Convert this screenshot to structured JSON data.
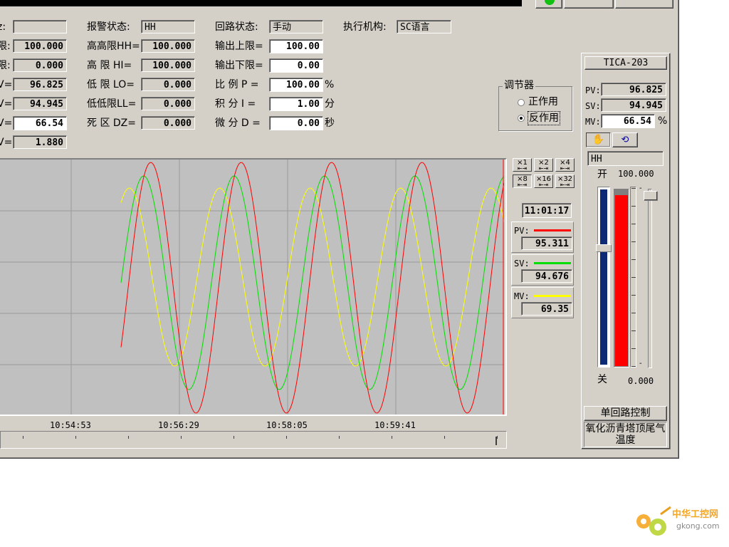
{
  "params": {
    "col1": [
      {
        "label": "z:",
        "value": ""
      },
      {
        "label": "限:",
        "value": "100.000"
      },
      {
        "label": "限:",
        "value": "0.000"
      },
      {
        "label": "V=",
        "value": "96.825"
      },
      {
        "label": "V=",
        "value": "94.945"
      },
      {
        "label": "V=",
        "value": "66.54"
      },
      {
        "label": "V=",
        "value": "1.880"
      }
    ],
    "col2": [
      {
        "label": "报警状态:",
        "value": "HH"
      },
      {
        "label": "高高限HH=",
        "value": "100.000"
      },
      {
        "label": "高 限 HI=",
        "value": "100.000"
      },
      {
        "label": "低 限 LO=",
        "value": "0.000"
      },
      {
        "label": "低低限LL=",
        "value": "0.000"
      },
      {
        "label": "死 区 DZ=",
        "value": "0.000"
      }
    ],
    "col3": [
      {
        "label": "回路状态:",
        "value": "手动",
        "unit": ""
      },
      {
        "label": "输出上限=",
        "value": "100.00",
        "unit": ""
      },
      {
        "label": "输出下限=",
        "value": "0.00",
        "unit": ""
      },
      {
        "label": "比 例 P =",
        "value": "100.00",
        "unit": "%"
      },
      {
        "label": "积 分 I =",
        "value": "1.00",
        "unit": "分"
      },
      {
        "label": "微 分 D =",
        "value": "0.00",
        "unit": "秒"
      }
    ],
    "actuator": {
      "label": "执行机构:",
      "value": "SC语言"
    }
  },
  "regulator": {
    "title": "调节器",
    "options": [
      {
        "label": "正作用",
        "selected": false
      },
      {
        "label": "反作用",
        "selected": true
      }
    ]
  },
  "zoom_buttons": [
    "×1",
    "×2",
    "×4",
    "×8",
    "×16",
    "×32"
  ],
  "zoom_selected": "×8",
  "trend": {
    "time": "11:01:17",
    "legend": [
      {
        "name": "PV:",
        "value": "95.311",
        "color": "#ff0000"
      },
      {
        "name": "SV:",
        "value": "94.676",
        "color": "#00dd00"
      },
      {
        "name": "MV:",
        "value": "69.35",
        "color": "#ffff00"
      }
    ],
    "time_labels": [
      "10:54:53",
      "10:56:29",
      "10:58:05",
      "10:59:41"
    ]
  },
  "faceplate": {
    "tag": "TICA-203",
    "pv_label": "PV:",
    "pv": "96.825",
    "sv_label": "SV:",
    "sv": "94.945",
    "mv_label": "MV:",
    "mv": "66.54",
    "mv_unit": "%",
    "alarm": "HH",
    "open_label": "开",
    "close_label": "关",
    "range_max": "100.000",
    "range_min": "0.000",
    "bar_fill_fraction": 0.97,
    "mode_button": "单回路控制",
    "description": "氧化沥青塔顶尾气温度"
  },
  "watermark": {
    "brand": "中华工控网",
    "url": "gkong.com"
  }
}
